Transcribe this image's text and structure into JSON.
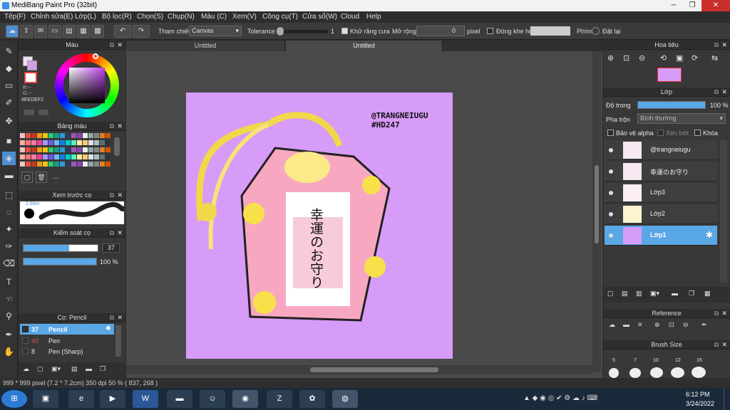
{
  "window": {
    "title": "MediBang Paint Pro (32bit)"
  },
  "menu": [
    "Tệp(F)",
    "Chỉnh sửa(E)",
    "Lớp(L)",
    "Bộ lọc(R)",
    "Chọn(S)",
    "Chụp(N)",
    "Màu (C)",
    "Xem(V)",
    "Công cụ(T)",
    "Cửa sổ(W)",
    "Cloud",
    "Help"
  ],
  "toolbar": {
    "ref_label": "Tham chiếu",
    "ref_value": "Canvas",
    "tolerance_label": "Tolerance",
    "tolerance_value": "1",
    "antialias_label": "Khử răng cưa",
    "expand_label": "Mở rộng",
    "expand_value": "0",
    "unit": "pixel",
    "close_gap_label": "Đóng khe hở",
    "key_label": "Phím",
    "reset_label": "Đặt lại"
  },
  "panels": {
    "color": {
      "title": "Màu",
      "r": "R:--",
      "g": "G:--",
      "hex": "#EEDEF2"
    },
    "palette": {
      "title": "Bảng màu",
      "extra": "---"
    },
    "brush_preview": {
      "title": "Xem trước cọ",
      "size": "2.69m"
    },
    "brush_control": {
      "title": "Kiểm soát cọ",
      "size": "37",
      "opacity": "100 %"
    },
    "brush_list": {
      "title": "Cọ: Pencil",
      "items": [
        {
          "size": "37",
          "name": "Pencil"
        },
        {
          "size": "40",
          "name": "Pen"
        },
        {
          "size": "8",
          "name": "Pen (Sharp)"
        }
      ]
    },
    "navigator": {
      "title": "Hoa tiêu"
    },
    "layer": {
      "title": "Lớp",
      "opacity_label": "Độ trong",
      "opacity_value": "100 %",
      "blend_label": "Pha trộn",
      "blend_value": "Bình thường",
      "protect_alpha": "Bảo vệ alpha",
      "clipping": "Xén bớt",
      "lock": "Khóa",
      "layers": [
        {
          "name": "@trangneiugu"
        },
        {
          "name": "幸運のお守り"
        },
        {
          "name": "Lớp3"
        },
        {
          "name": "Lớp2"
        },
        {
          "name": "Lớp1"
        }
      ]
    },
    "reference": {
      "title": "Reference"
    },
    "brush_size": {
      "title": "Brush Size",
      "sizes": [
        "5",
        "7",
        "10",
        "12",
        "15"
      ]
    }
  },
  "tabs": [
    "Untitled",
    "Untitled"
  ],
  "artwork": {
    "signature_line1": "@TRANGNEIUGU",
    "signature_line2": "#HD247",
    "charm_text": "幸運のお守り"
  },
  "status": {
    "text": "999 * 999 pixel  (7.2 * 7.2cm)  350 dpi  50 %  ( 837, 268 )"
  },
  "taskbar": {
    "time": "6:12 PM",
    "date": "3/24/2022"
  },
  "colors": {
    "accent": "#5aa7e6",
    "artboard": "#d79bf8",
    "charm": "#f7a8c0",
    "flower": "#f8e04a"
  }
}
